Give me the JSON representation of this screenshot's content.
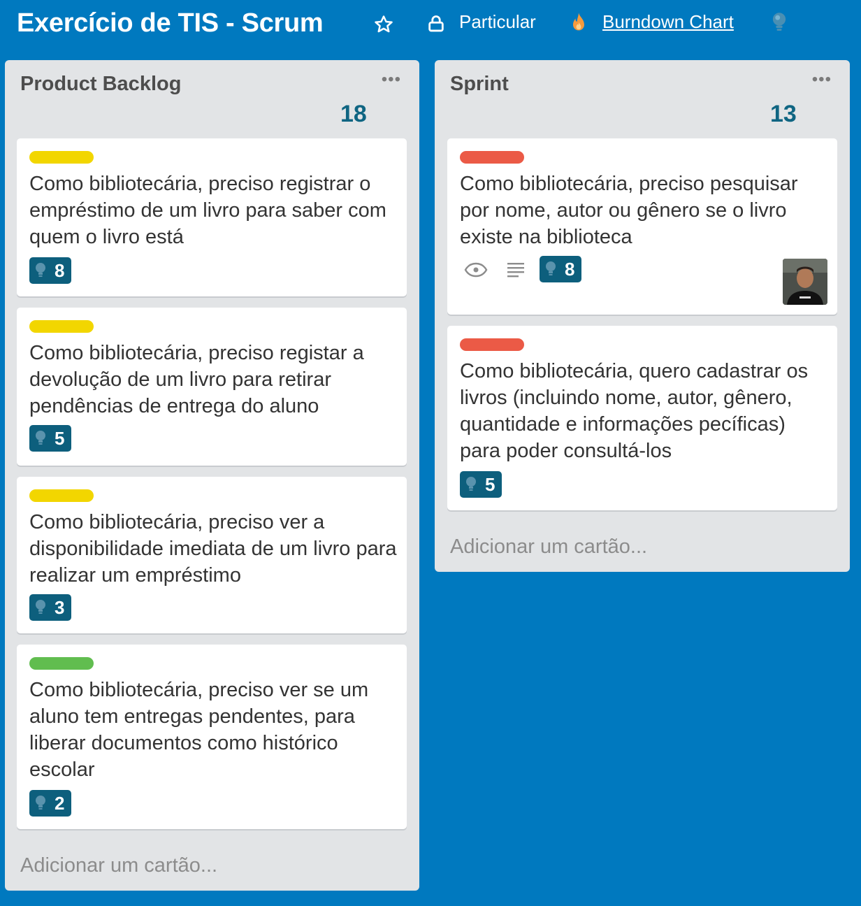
{
  "header": {
    "board_title": "Exercício de TIS - Scrum",
    "visibility_label": "Particular",
    "burndown_label": "Burndown Chart"
  },
  "colors": {
    "background": "#0079bf",
    "label_yellow": "#f2d600",
    "label_green": "#61bd4f",
    "label_red": "#eb5a46",
    "badge_bg": "#0d5f7d"
  },
  "lists": [
    {
      "title": "Product Backlog",
      "count": "18",
      "add_card_label": "Adicionar um cartão...",
      "cards": [
        {
          "label_color": "yellow",
          "text": "Como bibliotecária, preciso registrar o empréstimo de um livro para saber com quem o livro está",
          "points": "8"
        },
        {
          "label_color": "yellow",
          "text": "Como bibliotecária, preciso registar a devolução de um livro para retirar pendências de entrega do aluno",
          "points": "5"
        },
        {
          "label_color": "yellow",
          "text": "Como bibliotecária, preciso ver a disponibilidade imediata de um livro para realizar um empréstimo",
          "points": "3"
        },
        {
          "label_color": "green",
          "text": "Como bibliotecária, preciso ver se um aluno tem entregas pendentes, para liberar documentos como histórico escolar",
          "points": "2"
        }
      ]
    },
    {
      "title": "Sprint",
      "count": "13",
      "add_card_label": "Adicionar um cartão...",
      "cards": [
        {
          "label_color": "red",
          "text": "Como bibliotecária, preciso pesquisar por nome, autor ou gênero se o livro existe na biblioteca",
          "points": "8",
          "watching": true,
          "has_description": true,
          "has_member_avatar": true
        },
        {
          "label_color": "red",
          "text": "Como bibliotecária, quero cadastrar os livros (incluindo nome, autor, gênero, quantidade e informações pecíficas) para poder consultá-los",
          "points": "5"
        }
      ]
    }
  ]
}
